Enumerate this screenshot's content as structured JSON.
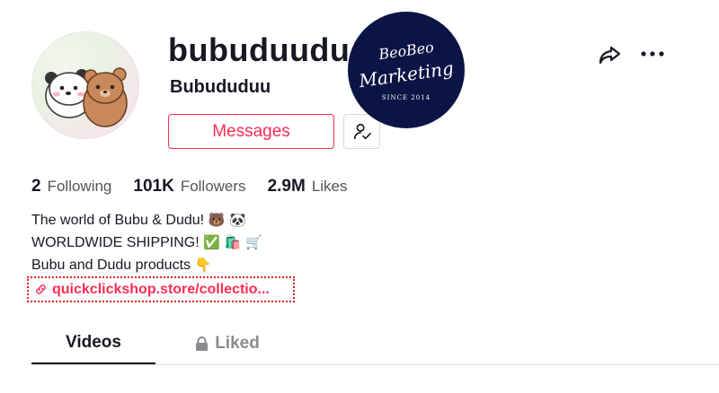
{
  "profile": {
    "username": "bubuduudu",
    "nickname": "Bubududuu"
  },
  "actions": {
    "messages_label": "Messages"
  },
  "stats": [
    {
      "value": "2",
      "label": "Following"
    },
    {
      "value": "101K",
      "label": "Followers"
    },
    {
      "value": "2.9M",
      "label": "Likes"
    }
  ],
  "bio": {
    "line1": "The world of Bubu & Dudu!",
    "line1_emoji": "🐻 🐼",
    "line2": "WORLDWIDE SHIPPING!",
    "line2_emoji": "✅ 🛍️ 🛒",
    "line3": "Bubu and Dudu products",
    "line3_emoji": "👇"
  },
  "link": {
    "text": "quickclickshop.store/collectio..."
  },
  "tabs": {
    "videos": "Videos",
    "liked": "Liked"
  },
  "watermark": {
    "line1": "BeoBeo",
    "line2": "Marketing",
    "line3": "SINCE 2014"
  },
  "icons": {
    "share": "share-icon",
    "more": "more-icon",
    "follow_status": "person-check-icon",
    "link": "link-icon",
    "lock": "lock-icon"
  },
  "colors": {
    "accent": "#fe2c55",
    "text": "#161823",
    "muted": "#8a8b91",
    "watermark_bg": "#0c1445"
  }
}
